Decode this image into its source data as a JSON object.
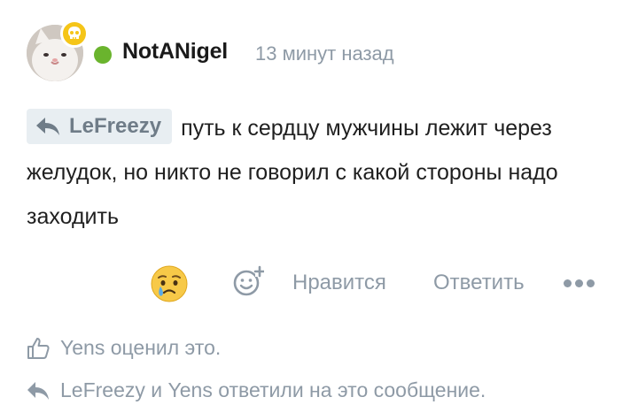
{
  "post": {
    "author": "NotANigel",
    "timestamp": "13 минут назад",
    "status": "online",
    "avatar_icon": "cat-avatar",
    "badge_icon": "skull-icon",
    "badge_color": "#f5c518",
    "online_color": "#6ab42d"
  },
  "message": {
    "reply_to": "LeFreezy",
    "text": "путь к сердцу мужчины лежит через желудок, но никто не говорил с какой стороны надо заходить"
  },
  "actions": {
    "reaction_icon": "crying-face-icon",
    "add_reaction_icon": "smiley-plus-icon",
    "like_label": "Нравится",
    "reply_label": "Ответить",
    "more_icon": "more-dots-icon"
  },
  "notes": {
    "liked_by": "Yens оценил это.",
    "replied_by": "LeFreezy и Yens ответили на это сообщение."
  },
  "colors": {
    "muted": "#8e9aa6",
    "chip_bg": "#e8eef2",
    "text": "#1f1f1f"
  }
}
